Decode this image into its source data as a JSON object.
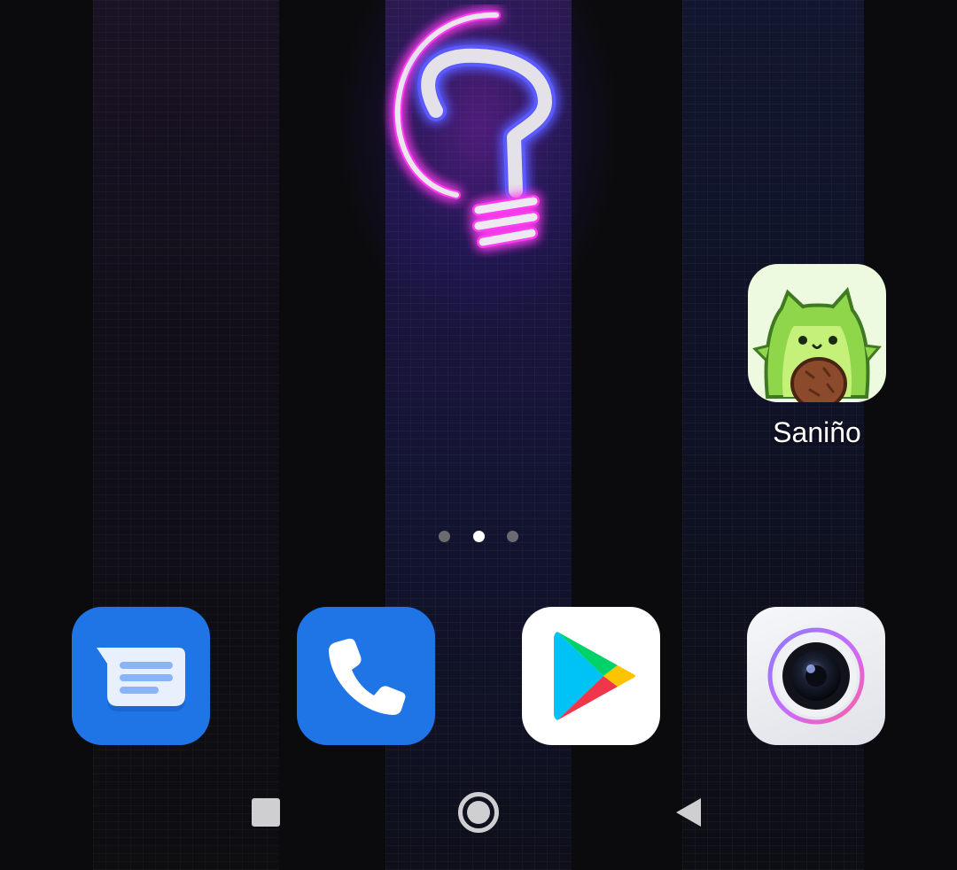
{
  "home": {
    "apps": [
      {
        "name": "Saniño",
        "icon": "avocado-icon"
      }
    ],
    "page_indicator": {
      "count": 3,
      "active_index": 1
    }
  },
  "dock": [
    {
      "icon": "messages-icon",
      "color": "#1a73e8"
    },
    {
      "icon": "phone-icon",
      "color": "#1a73e8"
    },
    {
      "icon": "play-store-icon",
      "color": "#ffffff"
    },
    {
      "icon": "camera-icon",
      "color": "#eceef2"
    }
  ],
  "nav": {
    "recents": "recents-icon",
    "home": "home-icon",
    "back": "back-icon"
  },
  "colors": {
    "wallpaper_bg": "#0b0b0d",
    "neon_pink": "#e040ff",
    "neon_blue": "#3060ff",
    "dot_inactive": "#6a6a70",
    "dot_active": "#ffffff"
  }
}
